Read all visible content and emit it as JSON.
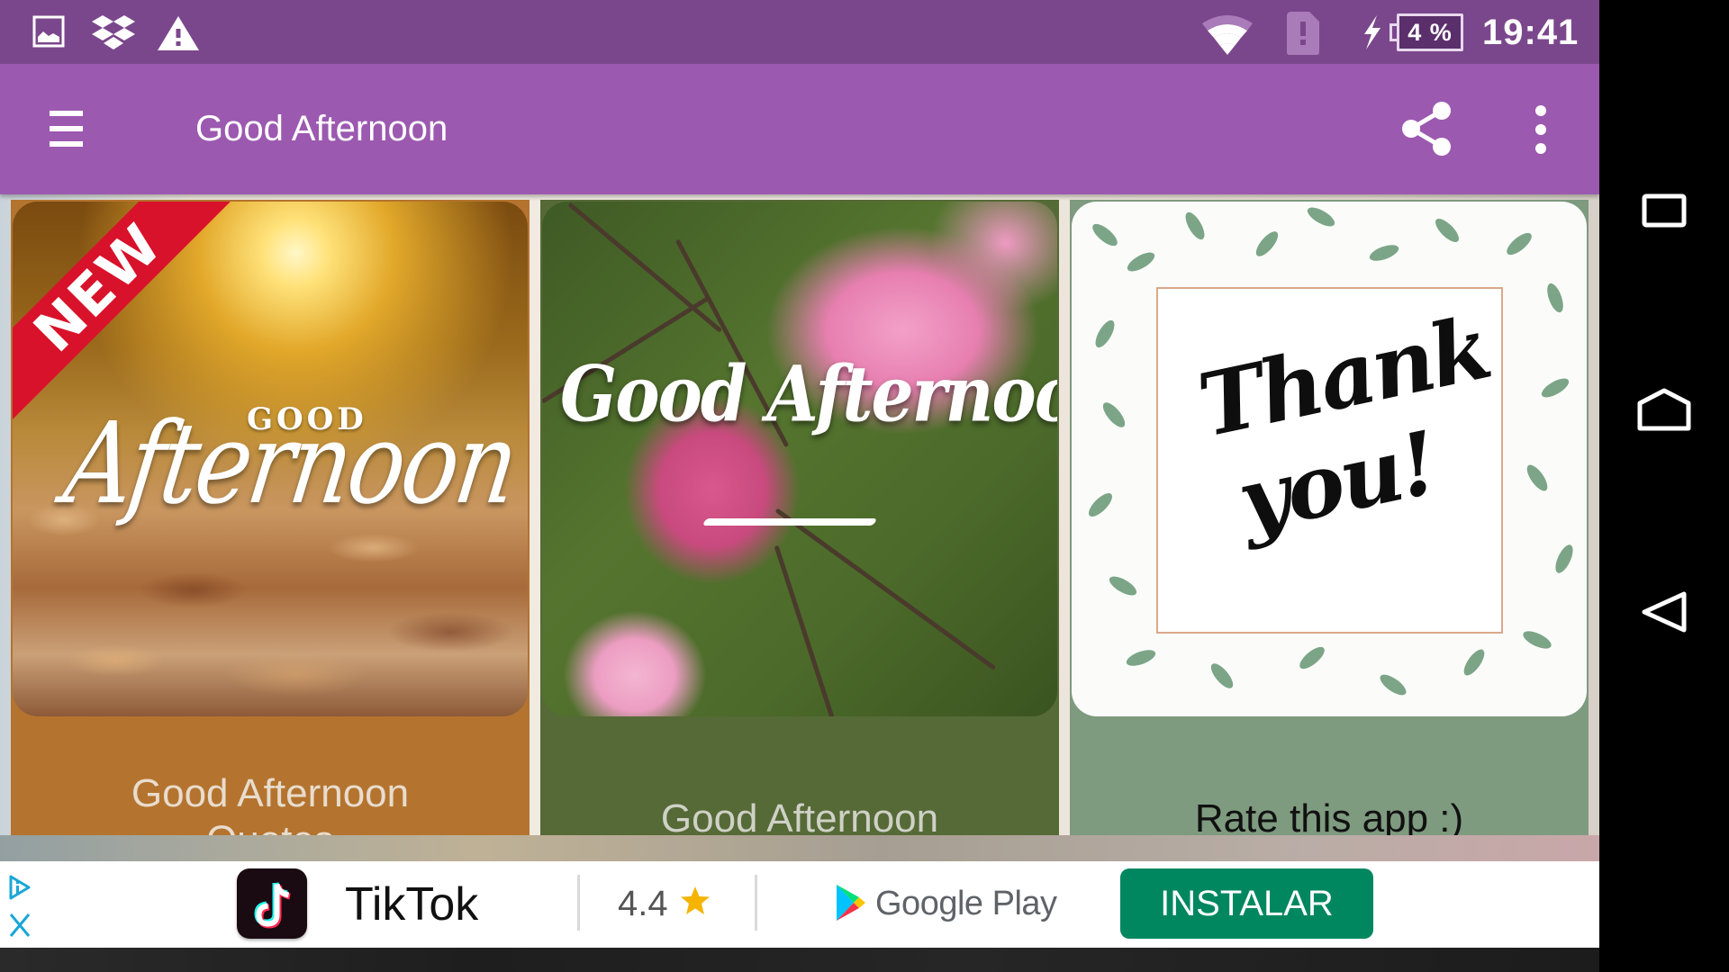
{
  "status_bar": {
    "left_icons": [
      "gallery-icon",
      "dropbox-icon",
      "warning-icon"
    ],
    "right_icons": [
      "wifi-icon",
      "sim-alert-icon",
      "charging-icon"
    ],
    "battery_percent": "4 %",
    "time": "19:41",
    "background": "#7b478c"
  },
  "toolbar": {
    "menu_icon": "hamburger-icon",
    "title": "Good Afternoon",
    "share_icon": "share-icon",
    "overflow_icon": "more-vert-icon",
    "background": "#9c59b0"
  },
  "cards": [
    {
      "badge": "NEW",
      "image_text_top": "GOOD",
      "image_text_main": "Afternoon",
      "caption": "Good Afternoon Quotes",
      "caption_line1": "Good Afternoon",
      "caption_line2": "Quotes",
      "color": "#b4742f"
    },
    {
      "image_text_main": "Good Afternoon",
      "caption": "Good Afternoon",
      "color": "#566a37"
    },
    {
      "image_text_line1": "Thank",
      "image_text_line2": "you!",
      "caption": "Rate this app :)",
      "color": "#7e9a7f"
    }
  ],
  "ad": {
    "info_icon": "ad-choices-icon",
    "close_icon": "close-icon",
    "app_name": "TikTok",
    "rating": "4.4",
    "rating_icon": "star-icon",
    "store": "Google Play",
    "install_label": "INSTALAR",
    "install_color": "#01875f"
  },
  "nav_bar": {
    "recents": "recents-icon",
    "home": "home-icon",
    "back": "back-icon"
  }
}
